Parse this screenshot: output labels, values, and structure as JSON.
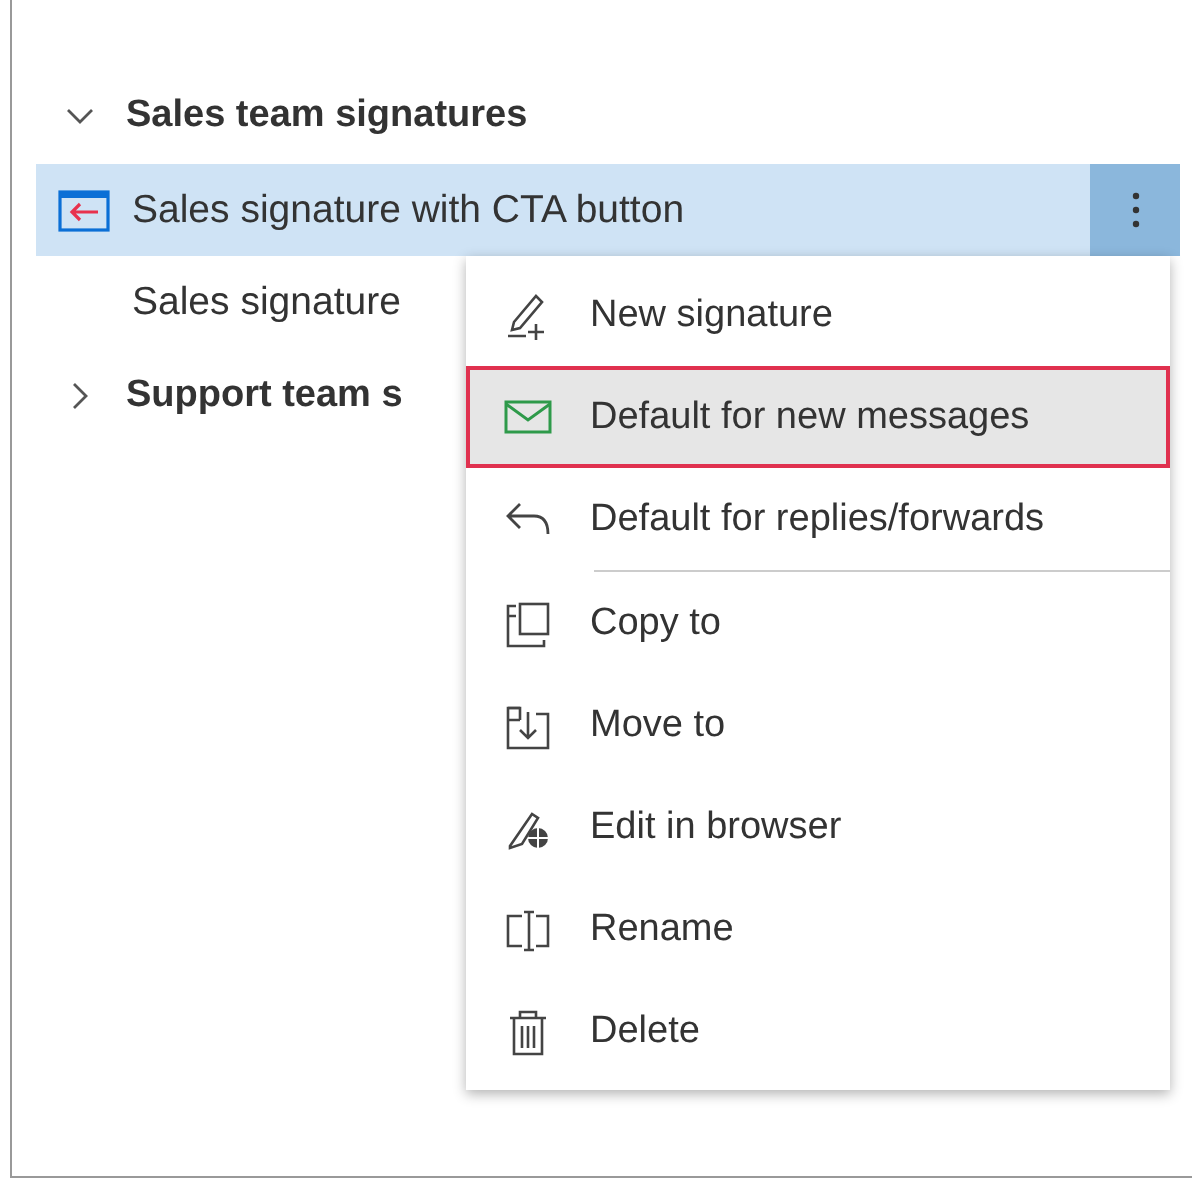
{
  "groups": [
    {
      "label": "Sales team signatures",
      "expanded": true,
      "children": [
        {
          "label": "Sales signature with CTA button",
          "selected": true,
          "kind": "html"
        },
        {
          "label": "Sales signature",
          "selected": false,
          "kind": "plain"
        }
      ]
    },
    {
      "label": "Support team s",
      "expanded": false
    }
  ],
  "context_menu": {
    "items": [
      {
        "label": "New signature",
        "kind": "new",
        "selected": false
      },
      {
        "label": "Default for new messages",
        "kind": "mail",
        "selected": true
      },
      {
        "label": "Default for replies/forwards",
        "kind": "reply",
        "selected": false,
        "divider_after": true
      },
      {
        "label": "Copy to",
        "kind": "copy",
        "selected": false
      },
      {
        "label": "Move to",
        "kind": "move",
        "selected": false
      },
      {
        "label": "Edit in browser",
        "kind": "browser",
        "selected": false
      },
      {
        "label": "Rename",
        "kind": "rename",
        "selected": false
      },
      {
        "label": "Delete",
        "kind": "delete",
        "selected": false
      }
    ]
  }
}
